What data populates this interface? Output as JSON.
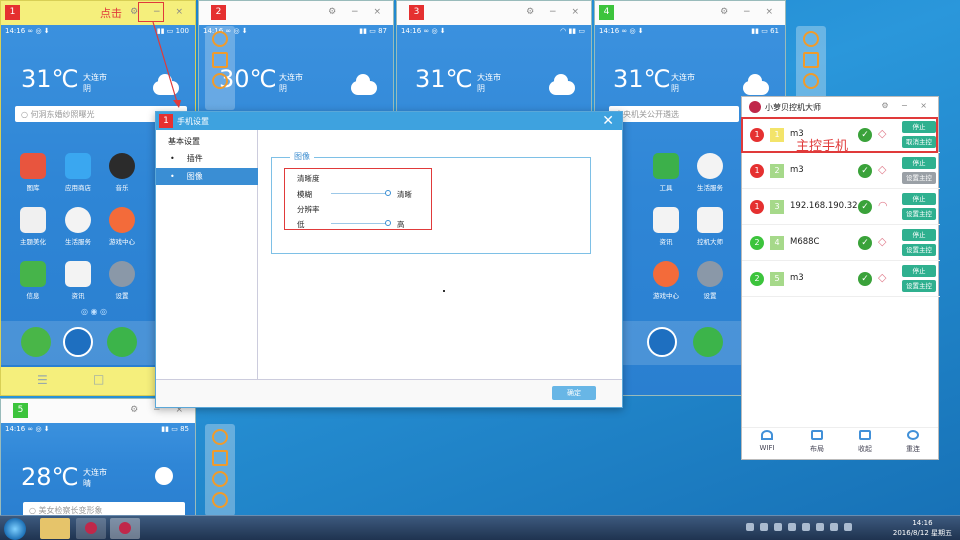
{
  "annotations": {
    "click_label": "点击",
    "master_phone_label": "主控手机"
  },
  "phones": [
    {
      "num": "1",
      "num_color": "#e53030",
      "time": "14:16",
      "battery": "100",
      "temp": "31℃",
      "city": "大连市",
      "weather": "阴",
      "search": "何洞东婚纱照曝光"
    },
    {
      "num": "2",
      "num_color": "#e53030",
      "time": "14:16",
      "battery": "87",
      "temp": "30℃",
      "city": "大连市",
      "weather": "阴"
    },
    {
      "num": "3",
      "num_color": "#e53030",
      "time": "14:16",
      "battery": "",
      "temp": "31℃",
      "city": "大连市",
      "weather": "阴"
    },
    {
      "num": "4",
      "num_color": "#3cc43c",
      "time": "14:16",
      "battery": "61",
      "temp": "31℃",
      "city": "大连市",
      "weather": "阴",
      "search": "中央机关公开遴选"
    },
    {
      "num": "5",
      "num_color": "#3cc43c",
      "time": "14:16",
      "battery": "85",
      "temp": "28℃",
      "city": "大连市",
      "weather": "晴",
      "search": "美女检察长变形象"
    }
  ],
  "phone1_apps": [
    {
      "label": "图库",
      "color": "#e8553e"
    },
    {
      "label": "应用商店",
      "color": "#3aa7f0"
    },
    {
      "label": "音乐",
      "color": "#2b2b2b"
    },
    {
      "label": "主题美化",
      "color": "#f0f0f0"
    },
    {
      "label": "生活服务",
      "color": "#f3f3f3"
    },
    {
      "label": "游戏中心",
      "color": "#f36b3a"
    },
    {
      "label": "信息",
      "color": "#46b44a"
    },
    {
      "label": "资讯",
      "color": "#f3f3f3"
    },
    {
      "label": "设置",
      "color": "#8a98a8"
    }
  ],
  "phone4_apps": [
    {
      "label": "工具",
      "color": "#3cb04a"
    },
    {
      "label": "生活服务",
      "color": "#f3f3f3"
    },
    {
      "label": "资讯",
      "color": "#f3f3f3"
    },
    {
      "label": "控机大师",
      "color": "#f3f3f3"
    },
    {
      "label": "游戏中心",
      "color": "#f36b3a"
    },
    {
      "label": "设置",
      "color": "#8a98a8"
    }
  ],
  "dialog": {
    "num": "1",
    "title": "手机设置",
    "sidebar_heading": "基本设置",
    "sidebar_items": [
      {
        "label": "插件"
      },
      {
        "label": "图像"
      }
    ],
    "group_title": "图像",
    "clarity_label": "清晰度",
    "clarity_min": "模糊",
    "clarity_max": "清晰",
    "clarity_level": 1.0,
    "resolution_label": "分辨率",
    "resolution_min": "低",
    "resolution_max": "高",
    "resolution_level": 1.0,
    "ok_label": "确定"
  },
  "master": {
    "title": "小萝贝控机大师",
    "rows": [
      {
        "status": "1",
        "status_color": "#e53030",
        "idx": "1",
        "idx_color": "#f3e46a",
        "name": "m3",
        "btn1": "停止",
        "btn2": "取消主控",
        "btn2_color": "#2fb08f",
        "signal": "tag"
      },
      {
        "status": "1",
        "status_color": "#e53030",
        "idx": "2",
        "idx_color": "#a6d98a",
        "name": "m3",
        "btn1": "停止",
        "btn2": "设置主控",
        "btn2_color": "#9aa0a6",
        "signal": "tag"
      },
      {
        "status": "1",
        "status_color": "#e53030",
        "idx": "3",
        "idx_color": "#a6d98a",
        "name": "192.168.190.32",
        "btn1": "停止",
        "btn2": "设置主控",
        "btn2_color": "#2fb08f",
        "signal": "wifi"
      },
      {
        "status": "2",
        "status_color": "#3cc43c",
        "idx": "4",
        "idx_color": "#a6d98a",
        "name": "M688C",
        "btn1": "停止",
        "btn2": "设置主控",
        "btn2_color": "#2fb08f",
        "signal": "tag"
      },
      {
        "status": "2",
        "status_color": "#3cc43c",
        "idx": "5",
        "idx_color": "#a6d98a",
        "name": "m3",
        "btn1": "停止",
        "btn2": "设置主控",
        "btn2_color": "#2fb08f",
        "signal": "tag"
      }
    ],
    "footer": [
      {
        "label": "WIFI"
      },
      {
        "label": "布局"
      },
      {
        "label": "收起"
      },
      {
        "label": "重连"
      }
    ]
  },
  "taskbar": {
    "time": "14:16",
    "date": "2016/8/12 星期五"
  }
}
